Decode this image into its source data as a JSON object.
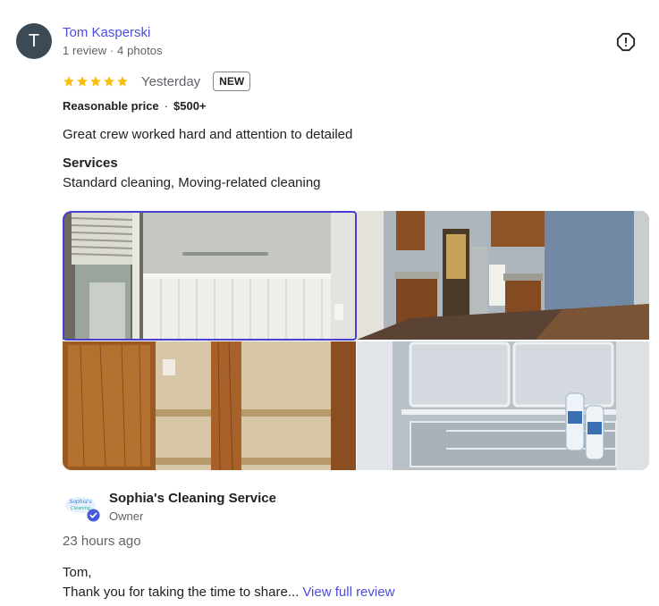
{
  "reviewer": {
    "initial": "T",
    "name": "Tom Kasperski",
    "meta": "1 review · 4 photos"
  },
  "review": {
    "rating": 5,
    "max_rating": 5,
    "date": "Yesterday",
    "badge": "NEW",
    "price_label": "Reasonable price",
    "price_value": "$500+",
    "text": "Great crew worked hard and attention to detailed",
    "services_heading": "Services",
    "services_value": "Standard cleaning, Moving-related cleaning"
  },
  "photos": [
    {
      "name": "bathroom-wall-photo"
    },
    {
      "name": "kitchen-photo"
    },
    {
      "name": "cabinet-shelves-photo"
    },
    {
      "name": "refrigerator-photo"
    }
  ],
  "owner_response": {
    "business_name": "Sophia's Cleaning Service",
    "role": "Owner",
    "time": "23 hours ago",
    "greeting": "Tom,",
    "text": "Thank you for taking the time to share...",
    "view_full_label": "View full review"
  },
  "icons": {
    "report": "report-icon",
    "star": "star-icon",
    "verified": "verified-check-icon"
  },
  "colors": {
    "link": "#4c4ce0",
    "star": "#fbbc04",
    "avatar_bg": "#3c4a56",
    "selected_outline": "#4a3fd4"
  }
}
